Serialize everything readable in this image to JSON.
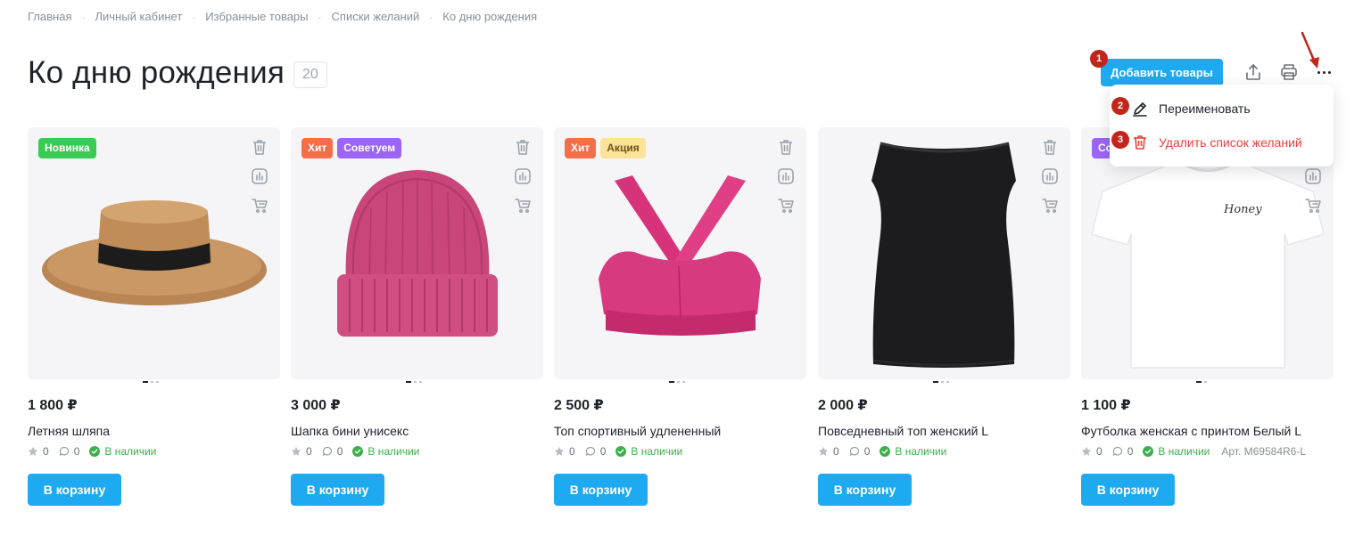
{
  "breadcrumb": [
    "Главная",
    "Личный кабинет",
    "Избранные товары",
    "Списки желаний",
    "Ко дню рождения"
  ],
  "breadcrumb_separator": "·",
  "page_title": "Ко дню рождения",
  "item_count": "20",
  "toolbar": {
    "add_button": "Добавить товары"
  },
  "dropdown": {
    "rename": "Переименовать",
    "delete": "Удалить список желаний"
  },
  "markers": [
    "1",
    "2",
    "3"
  ],
  "colors": {
    "accent": "#1eaaf1",
    "danger": "#e9413e",
    "marker": "#c2261b",
    "stock": "#3bb04a"
  },
  "products": [
    {
      "price": "1 800 ₽",
      "name": "Летняя шляпа",
      "rating": "0",
      "reviews": "0",
      "stock": "В наличии",
      "badges": [
        "Новинка"
      ],
      "cart": "В корзину"
    },
    {
      "price": "3 000 ₽",
      "name": "Шапка бини унисекс",
      "rating": "0",
      "reviews": "0",
      "stock": "В наличии",
      "badges": [
        "Хит",
        "Советуем"
      ],
      "cart": "В корзину"
    },
    {
      "price": "2 500 ₽",
      "name": "Топ спортивный удлененный",
      "rating": "0",
      "reviews": "0",
      "stock": "В наличии",
      "badges": [
        "Хит",
        "Акция"
      ],
      "cart": "В корзину"
    },
    {
      "price": "2 000 ₽",
      "name": "Повседневный топ женский L",
      "rating": "0",
      "reviews": "0",
      "stock": "В наличии",
      "badges": [],
      "cart": "В корзину"
    },
    {
      "price": "1 100 ₽",
      "name": "Футболка женская с принтом Белый L",
      "rating": "0",
      "reviews": "0",
      "stock": "В наличии",
      "badges": [
        "Со"
      ],
      "article": "Арт. M69584R6-L",
      "print_text": "Honey",
      "cart": "В корзину"
    }
  ]
}
